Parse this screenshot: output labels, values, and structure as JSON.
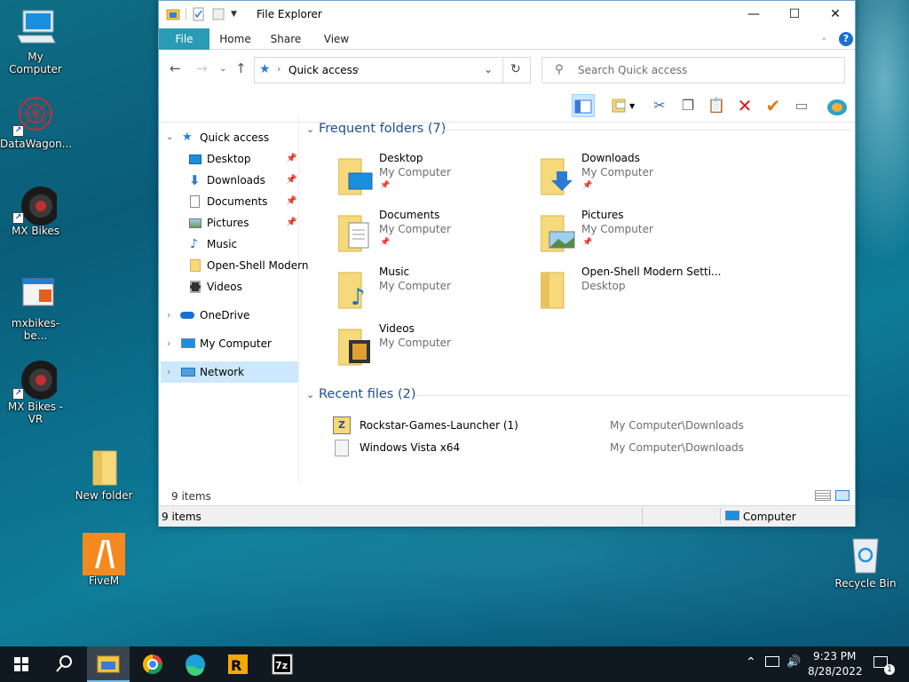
{
  "desktop": {
    "icons": [
      {
        "label": "My Computer"
      },
      {
        "label": "DataWagon..."
      },
      {
        "label": "MX Bikes"
      },
      {
        "label": "mxbikes-be..."
      },
      {
        "label": "MX Bikes - VR"
      },
      {
        "label": "New folder"
      },
      {
        "label": "FiveM"
      },
      {
        "label": "Recycle Bin"
      }
    ]
  },
  "window": {
    "title": "File Explorer",
    "ribbon_tabs": [
      "File",
      "Home",
      "Share",
      "View"
    ],
    "address": {
      "crumb": "Quick access"
    },
    "search_placeholder": "Search Quick access",
    "nav": {
      "quick_access": "Quick access",
      "pinned": [
        "Desktop",
        "Downloads",
        "Documents",
        "Pictures",
        "Music",
        "Open-Shell Modern",
        "Videos"
      ],
      "onedrive": "OneDrive",
      "my_computer": "My Computer",
      "network": "Network"
    },
    "frequent_title": "Frequent folders (7)",
    "frequent": [
      {
        "name": "Desktop",
        "loc": "My Computer"
      },
      {
        "name": "Downloads",
        "loc": "My Computer"
      },
      {
        "name": "Documents",
        "loc": "My Computer"
      },
      {
        "name": "Pictures",
        "loc": "My Computer"
      },
      {
        "name": "Music",
        "loc": "My Computer"
      },
      {
        "name": "Open-Shell Modern Setti...",
        "loc": "Desktop"
      },
      {
        "name": "Videos",
        "loc": "My Computer"
      }
    ],
    "recent_title": "Recent files (2)",
    "recent": [
      {
        "name": "Rockstar-Games-Launcher (1)",
        "loc": "My Computer\\Downloads"
      },
      {
        "name": "Windows Vista x64",
        "loc": "My Computer\\Downloads"
      }
    ],
    "status_count": "9 items",
    "statusbar_count": "9 items",
    "statusbar_location": "Computer"
  },
  "taskbar": {
    "time": "9:23 PM",
    "date": "8/28/2022",
    "notification_count": "1"
  }
}
